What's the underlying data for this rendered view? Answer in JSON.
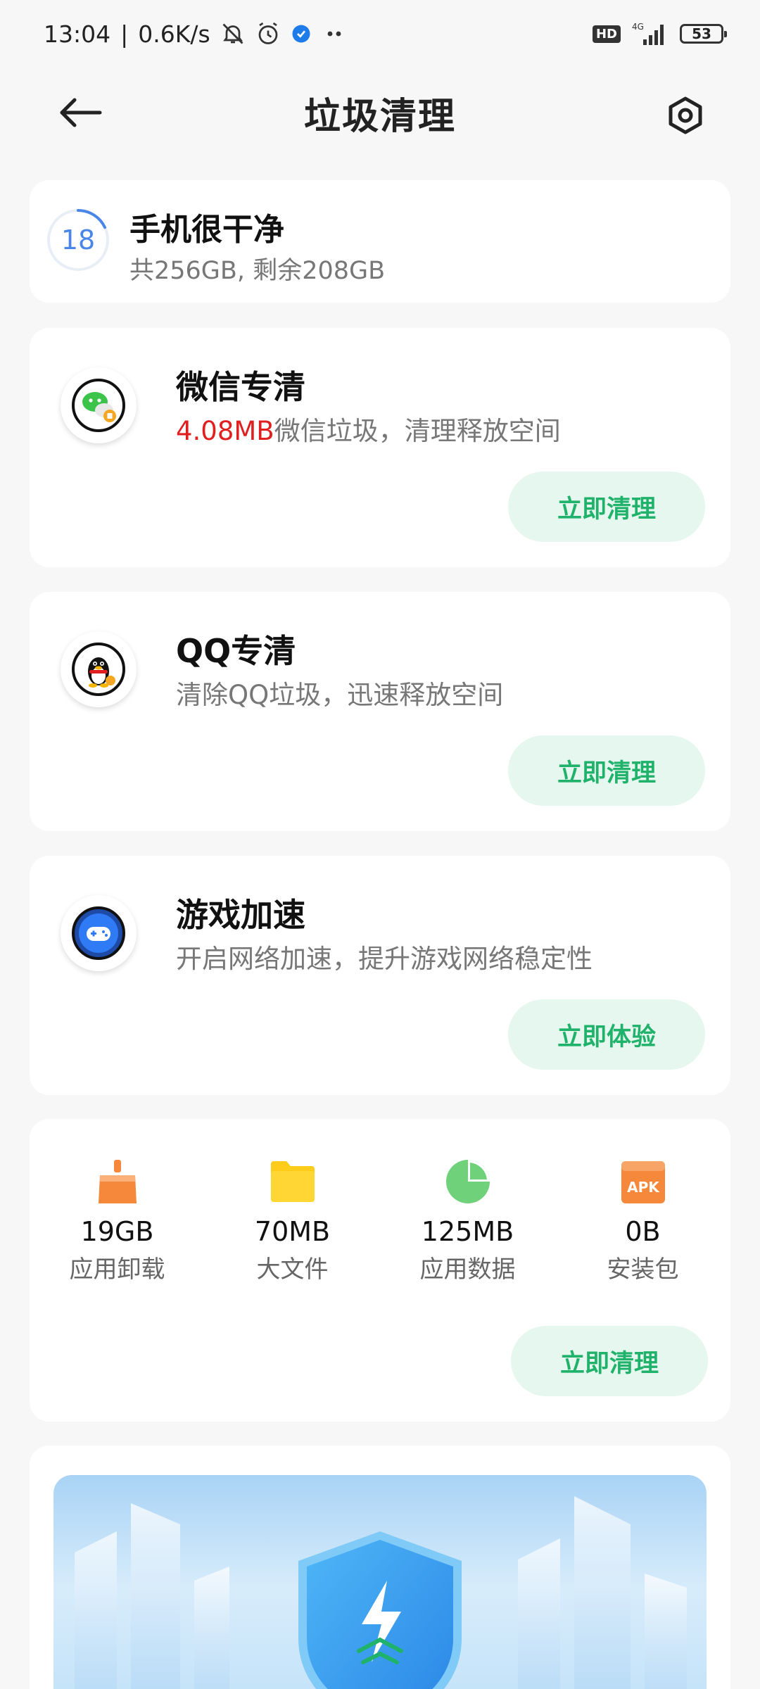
{
  "status_bar": {
    "time": "13:04",
    "speed": "0.6K/s",
    "hd": "HD",
    "network": "4G",
    "battery": "53",
    "icons": [
      "mute-bell-icon",
      "alarm-icon",
      "app-notification-icon",
      "more-dots-icon",
      "signal-icon",
      "battery-icon"
    ]
  },
  "header": {
    "title": "垃圾清理",
    "back_icon": "back-arrow-icon",
    "settings_icon": "settings-hexagon-icon"
  },
  "summary": {
    "score": "18",
    "title": "手机很干净",
    "storage": "共256GB, 剩余208GB",
    "ring_progress": 0.18
  },
  "features": [
    {
      "id": "wechat",
      "title": "微信专清",
      "highlight": "4.08MB",
      "desc": "微信垃圾，清理释放空间",
      "button": "立即清理",
      "icon": "wechat-clean-icon"
    },
    {
      "id": "qq",
      "title": "QQ专清",
      "highlight": "",
      "desc": "清除QQ垃圾，迅速释放空间",
      "button": "立即清理",
      "icon": "qq-penguin-icon"
    },
    {
      "id": "game",
      "title": "游戏加速",
      "highlight": "",
      "desc": "开启网络加速，提升游戏网络稳定性",
      "button": "立即体验",
      "icon": "game-controller-icon"
    }
  ],
  "stats": {
    "items": [
      {
        "value": "19GB",
        "label": "应用卸载",
        "icon": "broom-icon",
        "color": "#f5883b"
      },
      {
        "value": "70MB",
        "label": "大文件",
        "icon": "folder-icon",
        "color": "#ffcc1a"
      },
      {
        "value": "125MB",
        "label": "应用数据",
        "icon": "pie-chart-icon",
        "color": "#6fd27a"
      },
      {
        "value": "0B",
        "label": "安装包",
        "icon": "apk-package-icon",
        "color": "#f5883b"
      }
    ],
    "apk_text": "APK",
    "button": "立即清理"
  },
  "colors": {
    "accent_green": "#20b26b",
    "button_bg": "#e5f7ee",
    "highlight_red": "#e02020",
    "score_blue": "#4a86e8"
  }
}
